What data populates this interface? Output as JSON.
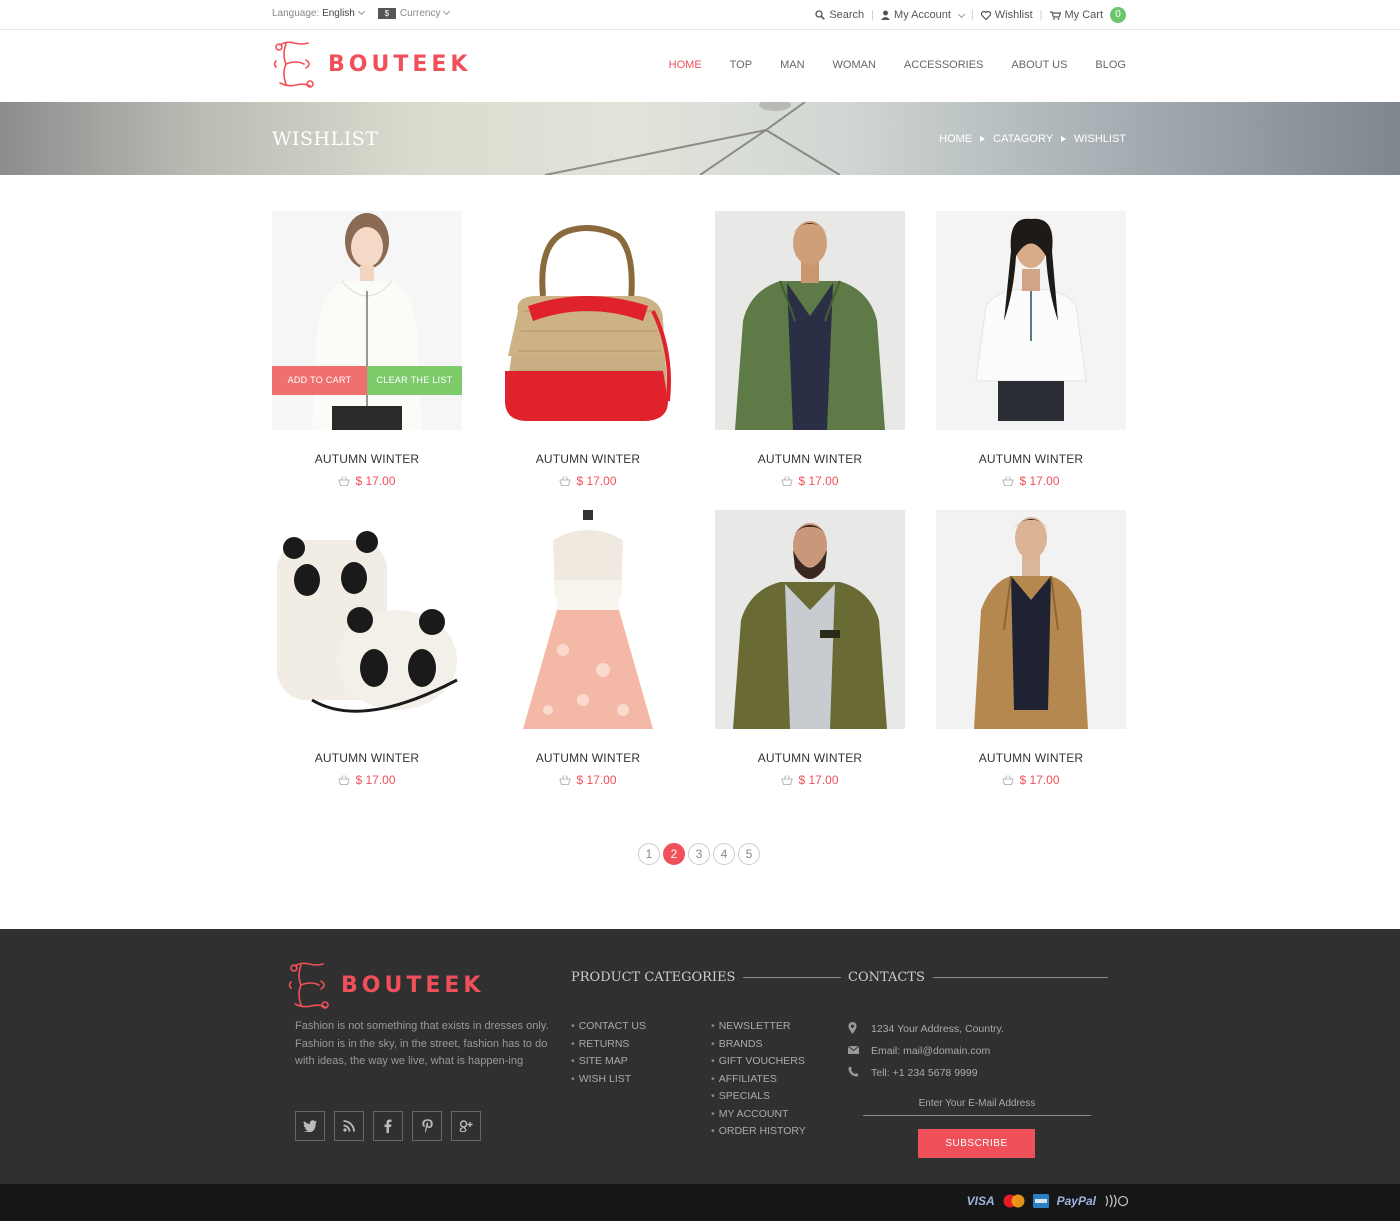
{
  "topbar": {
    "language_label": "Language:",
    "language_value": "English",
    "currency_label": "Currency",
    "search": "Search",
    "account": "My Account",
    "wishlist": "Wishlist",
    "cart": "My Cart",
    "cart_count": "0"
  },
  "brand": {
    "name": "BOUTEEK"
  },
  "nav": [
    "HOME",
    "TOP",
    "MAN",
    "WOMAN",
    "ACCESSORIES",
    "ABOUT US",
    "BLOG"
  ],
  "banner": {
    "title": "WISHLIST",
    "breadcrumb": [
      "HOME",
      "CATAGORY",
      "WISHLIST"
    ]
  },
  "products": [
    {
      "name": "AUTUMN WINTER",
      "price": "$ 17.00",
      "image": "woman-white-shirt"
    },
    {
      "name": "AUTUMN WINTER",
      "price": "$ 17.00",
      "image": "handbag"
    },
    {
      "name": "AUTUMN WINTER",
      "price": "$ 17.00",
      "image": "man-green-jacket"
    },
    {
      "name": "AUTUMN WINTER",
      "price": "$ 17.00",
      "image": "woman-white-top"
    },
    {
      "name": "AUTUMN WINTER",
      "price": "$ 17.00",
      "image": "panda-backpack"
    },
    {
      "name": "AUTUMN WINTER",
      "price": "$ 17.00",
      "image": "pink-dress"
    },
    {
      "name": "AUTUMN WINTER",
      "price": "$ 17.00",
      "image": "bearded-man-jacket"
    },
    {
      "name": "AUTUMN WINTER",
      "price": "$ 17.00",
      "image": "man-trench-coat"
    }
  ],
  "overlay": {
    "add_to_cart": "ADD TO CART",
    "clear_list": "CLEAR THE LIST"
  },
  "pagination": {
    "pages": [
      "1",
      "2",
      "3",
      "4",
      "5"
    ],
    "current": "2"
  },
  "footer": {
    "about": "Fashion is not something that exists in dresses only. Fashion is in the sky, in the street, fashion has to do with ideas, the way we live, what is happen-ing",
    "socials": [
      "twitter-icon",
      "rss-icon",
      "facebook-icon",
      "pinterest-icon",
      "google-plus-icon"
    ],
    "categories_title": "PRODUCT CATEGORIES",
    "links_col1": [
      "CONTACT US",
      "RETURNS",
      "SITE MAP",
      "WISH LIST"
    ],
    "links_col2": [
      "NEWSLETTER",
      "BRANDS",
      "GIFT VOUCHERS",
      "AFFILIATES",
      "SPECIALS",
      "MY ACCOUNT",
      "ORDER HISTORY"
    ],
    "contacts_title": "CONTACTS",
    "address": "1234 Your Address, Country.",
    "email": "Email: mail@domain.com",
    "phone": "Tell: +1 234 5678 9999",
    "email_placeholder": "Enter Your E-Mail Address",
    "subscribe": "SUBSCRIBE"
  },
  "payments": [
    "VISA",
    "MasterCard",
    "American Express",
    "PayPal",
    "Contactless"
  ],
  "colors": {
    "accent": "#f0505a",
    "green": "#7dcb6b",
    "footer_bg": "#303030"
  }
}
